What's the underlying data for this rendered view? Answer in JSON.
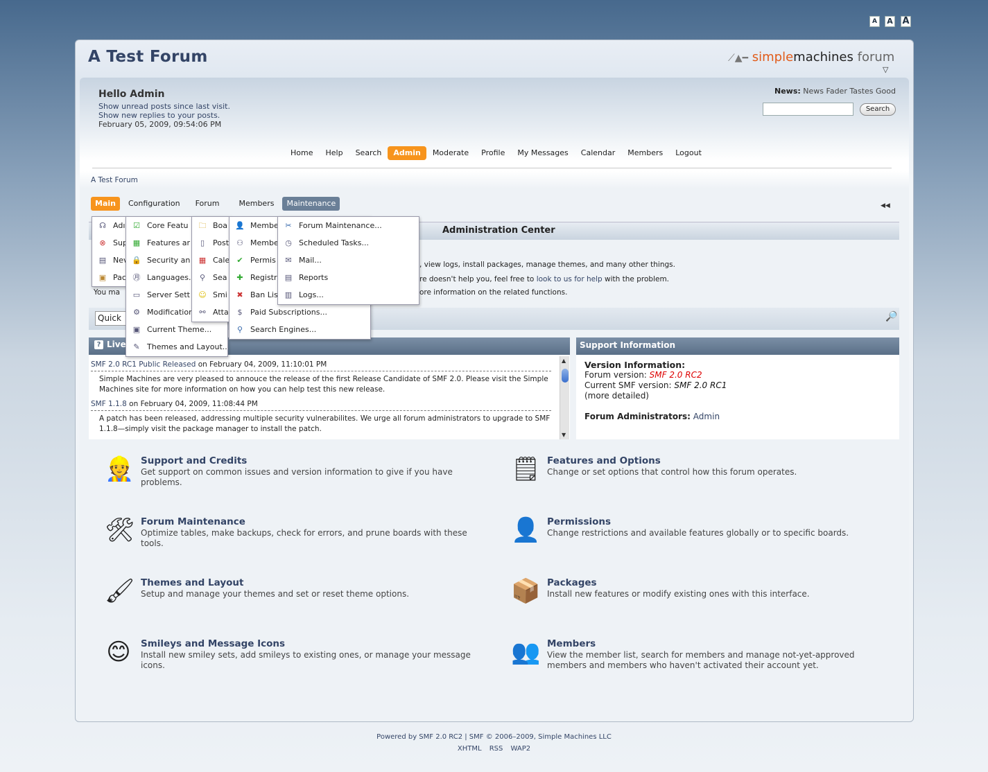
{
  "font_sizes": [
    "A",
    "A",
    "A"
  ],
  "header": {
    "forum_title": "A Test Forum",
    "logo": {
      "part1": "simple",
      "part2": "machines",
      "part3": " forum"
    },
    "toggle": "▽"
  },
  "user": {
    "hello": "Hello Admin",
    "unread": "Show unread posts since last visit.",
    "replies": "Show new replies to your posts.",
    "date": "February 05, 2009, 09:54:06 PM"
  },
  "news": {
    "label": "News:",
    "text": " News Fader Tastes Good"
  },
  "search": {
    "button": "Search",
    "placeholder": ""
  },
  "main_menu": [
    "Home",
    "Help",
    "Search",
    "Admin",
    "Moderate",
    "Profile",
    "My Messages",
    "Calendar",
    "Members",
    "Logout"
  ],
  "breadcrumb": "A Test Forum",
  "admin_tabs": [
    "Main",
    "Configuration",
    "Forum",
    "Members",
    "Maintenance"
  ],
  "collapse_icon": "◀◀",
  "admin_center": {
    "title": "Administration Center",
    "line1": ", view logs, install packages, manage themes, and many other things.",
    "line2a": "re doesn't help you, feel free to ",
    "line2link": "look to us for help",
    "line2b": " with the problem.",
    "line3": "ore information on the related functions.",
    "youmay": "You ma"
  },
  "quick": {
    "value": "Quick"
  },
  "live": {
    "title": "Live",
    "items": [
      {
        "link": "SMF 2.0 RC1 Public Released",
        "date": " on February 04, 2009, 11:10:01 PM",
        "body": "Simple Machines are very pleased to annouce the release of the first Release Candidate of SMF 2.0. Please visit the Simple Machines site for more information on how you can help test this new release."
      },
      {
        "link": "SMF 1.1.8",
        "date": " on February 04, 2009, 11:08:44 PM",
        "body": "A patch has been released, addressing multiple security vulnerabilites. We urge all forum administrators to upgrade to SMF 1.1.8—simply visit the package manager to install the patch."
      }
    ]
  },
  "support": {
    "title": "Support Information",
    "version_label": "Version Information:",
    "forum_version_label": "Forum version: ",
    "forum_version": "SMF 2.0 RC2",
    "current_label": "Current SMF version: ",
    "current_version": "SMF 2.0 RC1",
    "more": "(more detailed)",
    "admins_label": "Forum Administrators:",
    "admins": " Admin"
  },
  "sections": [
    {
      "title": "Support and Credits",
      "desc": "Get support on common issues and version information to give if you have problems.",
      "icon": "support-icon"
    },
    {
      "title": "Features and Options",
      "desc": "Change or set options that control how this forum operates.",
      "icon": "features-icon"
    },
    {
      "title": "Forum Maintenance",
      "desc": "Optimize tables, make backups, check for errors, and prune boards with these tools.",
      "icon": "maintenance-icon"
    },
    {
      "title": "Permissions",
      "desc": "Change restrictions and available features globally or to specific boards.",
      "icon": "permissions-icon"
    },
    {
      "title": "Themes and Layout",
      "desc": "Setup and manage your themes and set or reset theme options.",
      "icon": "themes-icon"
    },
    {
      "title": "Packages",
      "desc": "Install new features or modify existing ones with this interface.",
      "icon": "packages-icon"
    },
    {
      "title": "Smileys and Message Icons",
      "desc": "Install new smiley sets, add smileys to existing ones, or manage your message icons.",
      "icon": "smiley-icon"
    },
    {
      "title": "Members",
      "desc": "View the member list, search for members and manage not-yet-approved members and members who haven't activated their account yet.",
      "icon": "members-icon"
    }
  ],
  "dropdowns": {
    "main": [
      "Adı",
      "Sup",
      "Nev",
      "Pac"
    ],
    "configuration": [
      "Core Featu",
      "Features ar",
      "Security an",
      "Languages.",
      "Server Sett",
      "Modification",
      "Current Theme...",
      "Themes and Layout..."
    ],
    "forum": [
      "Boa",
      "Post",
      "Cale",
      "Sea",
      "Smi",
      "Atta"
    ],
    "members": [
      "Membe",
      "Membe",
      "Permis",
      "Registr",
      "Ban Lis",
      "Paid Subscriptions...",
      "Search Engines..."
    ],
    "maintenance": [
      "Forum Maintenance...",
      "Scheduled Tasks...",
      "Mail...",
      "Reports",
      "Logs..."
    ]
  },
  "footer": {
    "powered": "Powered by SMF 2.0 RC2 | SMF © 2006–2009, Simple Machines LLC",
    "links": "XHTML RSS WAP2"
  },
  "colors": {
    "accent": "#f7941d",
    "link": "#334466",
    "tab_active": "#6a7f97",
    "red": "#dd0000"
  }
}
